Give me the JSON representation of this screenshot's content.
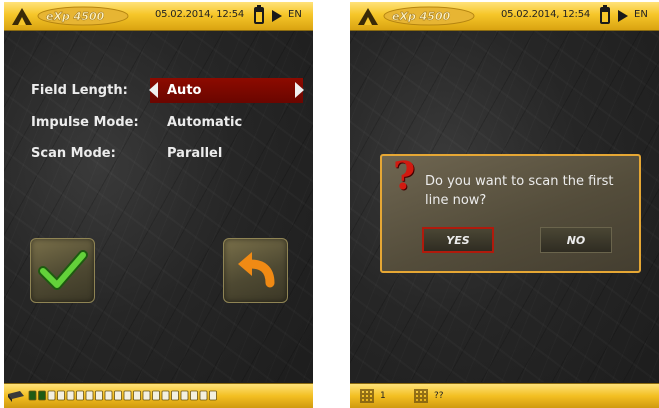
{
  "left_screen": {
    "header": {
      "logo_text": "eXp 4500",
      "datetime": "05.02.2014, 12:54",
      "language": "EN"
    },
    "settings": [
      {
        "label": "Field Length:",
        "value": "Auto"
      },
      {
        "label": "Impulse Mode:",
        "value": "Automatic"
      },
      {
        "label": "Scan Mode:",
        "value": "Parallel"
      }
    ],
    "buttons": {
      "confirm_icon": "checkmark-icon",
      "back_icon": "undo-arrow-icon"
    },
    "footer": {
      "progress_segments_total": 20,
      "progress_segments_active": 2
    }
  },
  "right_screen": {
    "header": {
      "logo_text": "eXp 4500",
      "datetime": "05.02.2014, 12:54",
      "language": "EN"
    },
    "dialog": {
      "icon": "question-mark-icon",
      "question_symbol": "?",
      "message": "Do you want to scan the first line now?",
      "yes_label": "YES",
      "no_label": "NO"
    },
    "footer": {
      "line_count": "1",
      "field_count": "??"
    }
  },
  "colors": {
    "accent_yellow": "#f6c629",
    "selection_red": "#8d0a00",
    "dialog_border": "#e6a734"
  }
}
